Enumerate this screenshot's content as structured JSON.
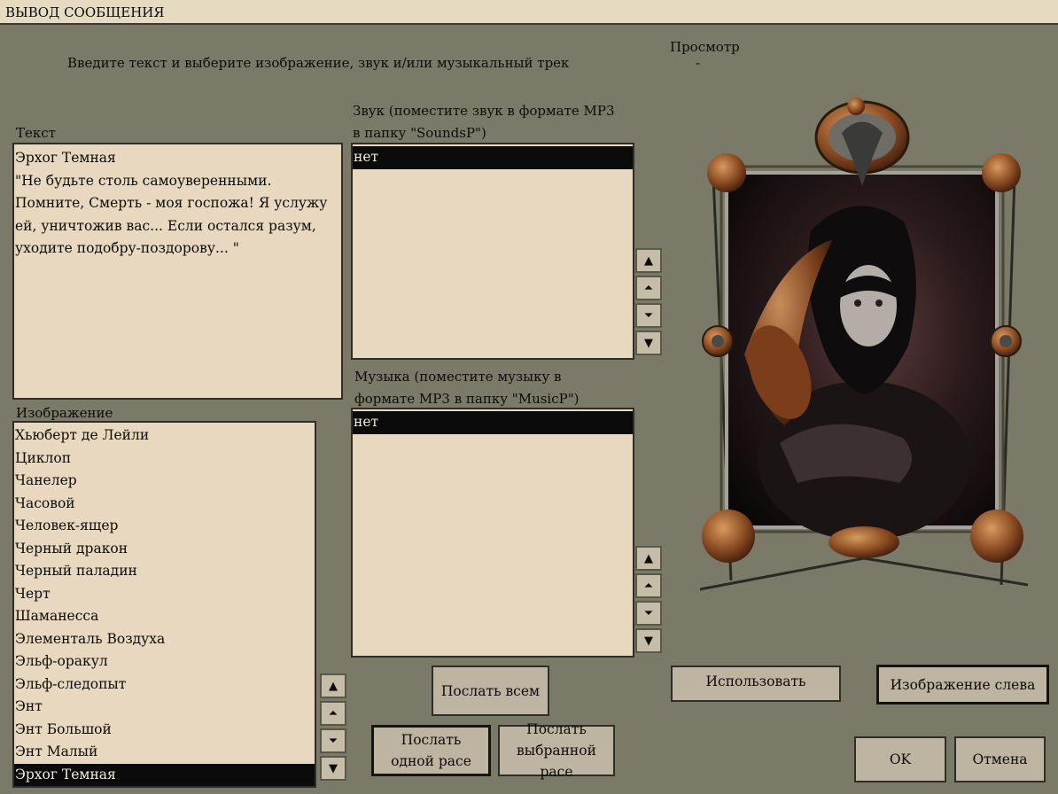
{
  "window": {
    "title": "ВЫВОД СООБЩЕНИЯ"
  },
  "instruction": "Введите текст и выберите изображение, звук и/или музыкальный трек",
  "preview": {
    "label": "Просмотр",
    "value": "-"
  },
  "text_section": {
    "label": "Текст",
    "lines": [
      "Эрхог Темная",
      "\"Не будьте столь самоуверенными.",
      "Помните, Смерть - моя госпожа! Я услужу",
      "ей, уничтожив вас... Если остался разум,",
      "уходите подобру-поздорову... \""
    ]
  },
  "image_section": {
    "label": "Изображение",
    "items": [
      "Хьюберт де Лейли",
      "Циклоп",
      "Чанелер",
      "Часовой",
      "Человек-ящер",
      "Черный дракон",
      "Черный паладин",
      "Черт",
      "Шаманесса",
      "Элементаль Воздуха",
      "Эльф-оракул",
      "Эльф-следопыт",
      "Энт",
      "Энт Большой",
      "Энт Малый",
      "Эрхог Темная"
    ],
    "selected": "Эрхог Темная"
  },
  "sound_section": {
    "label_line1": "Звук (поместите звук в формате MP3",
    "label_line2": "в папку \"SoundsP\")",
    "items": [
      "нет"
    ]
  },
  "music_section": {
    "label_line1": "Музыка (поместите музыку в",
    "label_line2": "формате MP3 в папку \"MusicP\")",
    "items": [
      "нет"
    ]
  },
  "scroll_icons": {
    "top": "▲",
    "up": "⏶",
    "down": "⏷",
    "bottom": "▼"
  },
  "buttons": {
    "send_all": "Послать всем",
    "send_one_race_l1": "Послать",
    "send_one_race_l2": "одной расе",
    "send_selected_race_l1": "Послать",
    "send_selected_race_l2": "выбранной расе",
    "use": "Использовать",
    "image_left": "Изображение слева",
    "ok": "OK",
    "cancel": "Отмена"
  },
  "colors": {
    "background": "#7b7a69",
    "field": "#e8d8bf",
    "button": "#bdb5a1",
    "selection": "#0b0b0b",
    "frame_copper": "#8a4a22"
  }
}
